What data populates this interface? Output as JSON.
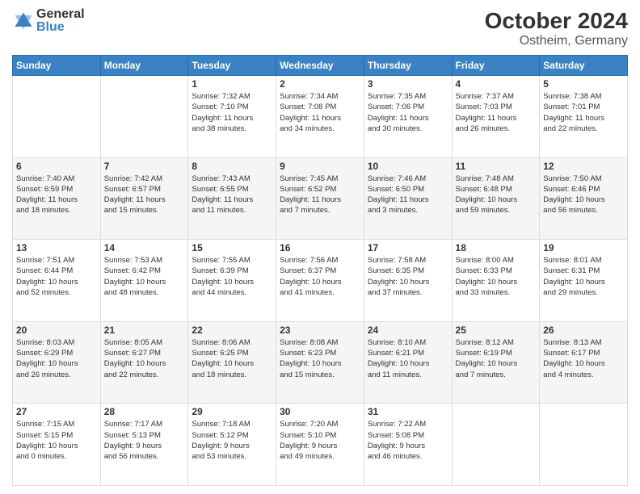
{
  "logo": {
    "general": "General",
    "blue": "Blue"
  },
  "title": "October 2024",
  "subtitle": "Ostheim, Germany",
  "days_of_week": [
    "Sunday",
    "Monday",
    "Tuesday",
    "Wednesday",
    "Thursday",
    "Friday",
    "Saturday"
  ],
  "weeks": [
    [
      {
        "day": "",
        "info": ""
      },
      {
        "day": "",
        "info": ""
      },
      {
        "day": "1",
        "info": "Sunrise: 7:32 AM\nSunset: 7:10 PM\nDaylight: 11 hours\nand 38 minutes."
      },
      {
        "day": "2",
        "info": "Sunrise: 7:34 AM\nSunset: 7:08 PM\nDaylight: 11 hours\nand 34 minutes."
      },
      {
        "day": "3",
        "info": "Sunrise: 7:35 AM\nSunset: 7:06 PM\nDaylight: 11 hours\nand 30 minutes."
      },
      {
        "day": "4",
        "info": "Sunrise: 7:37 AM\nSunset: 7:03 PM\nDaylight: 11 hours\nand 26 minutes."
      },
      {
        "day": "5",
        "info": "Sunrise: 7:38 AM\nSunset: 7:01 PM\nDaylight: 11 hours\nand 22 minutes."
      }
    ],
    [
      {
        "day": "6",
        "info": "Sunrise: 7:40 AM\nSunset: 6:59 PM\nDaylight: 11 hours\nand 18 minutes."
      },
      {
        "day": "7",
        "info": "Sunrise: 7:42 AM\nSunset: 6:57 PM\nDaylight: 11 hours\nand 15 minutes."
      },
      {
        "day": "8",
        "info": "Sunrise: 7:43 AM\nSunset: 6:55 PM\nDaylight: 11 hours\nand 11 minutes."
      },
      {
        "day": "9",
        "info": "Sunrise: 7:45 AM\nSunset: 6:52 PM\nDaylight: 11 hours\nand 7 minutes."
      },
      {
        "day": "10",
        "info": "Sunrise: 7:46 AM\nSunset: 6:50 PM\nDaylight: 11 hours\nand 3 minutes."
      },
      {
        "day": "11",
        "info": "Sunrise: 7:48 AM\nSunset: 6:48 PM\nDaylight: 10 hours\nand 59 minutes."
      },
      {
        "day": "12",
        "info": "Sunrise: 7:50 AM\nSunset: 6:46 PM\nDaylight: 10 hours\nand 56 minutes."
      }
    ],
    [
      {
        "day": "13",
        "info": "Sunrise: 7:51 AM\nSunset: 6:44 PM\nDaylight: 10 hours\nand 52 minutes."
      },
      {
        "day": "14",
        "info": "Sunrise: 7:53 AM\nSunset: 6:42 PM\nDaylight: 10 hours\nand 48 minutes."
      },
      {
        "day": "15",
        "info": "Sunrise: 7:55 AM\nSunset: 6:39 PM\nDaylight: 10 hours\nand 44 minutes."
      },
      {
        "day": "16",
        "info": "Sunrise: 7:56 AM\nSunset: 6:37 PM\nDaylight: 10 hours\nand 41 minutes."
      },
      {
        "day": "17",
        "info": "Sunrise: 7:58 AM\nSunset: 6:35 PM\nDaylight: 10 hours\nand 37 minutes."
      },
      {
        "day": "18",
        "info": "Sunrise: 8:00 AM\nSunset: 6:33 PM\nDaylight: 10 hours\nand 33 minutes."
      },
      {
        "day": "19",
        "info": "Sunrise: 8:01 AM\nSunset: 6:31 PM\nDaylight: 10 hours\nand 29 minutes."
      }
    ],
    [
      {
        "day": "20",
        "info": "Sunrise: 8:03 AM\nSunset: 6:29 PM\nDaylight: 10 hours\nand 26 minutes."
      },
      {
        "day": "21",
        "info": "Sunrise: 8:05 AM\nSunset: 6:27 PM\nDaylight: 10 hours\nand 22 minutes."
      },
      {
        "day": "22",
        "info": "Sunrise: 8:06 AM\nSunset: 6:25 PM\nDaylight: 10 hours\nand 18 minutes."
      },
      {
        "day": "23",
        "info": "Sunrise: 8:08 AM\nSunset: 6:23 PM\nDaylight: 10 hours\nand 15 minutes."
      },
      {
        "day": "24",
        "info": "Sunrise: 8:10 AM\nSunset: 6:21 PM\nDaylight: 10 hours\nand 11 minutes."
      },
      {
        "day": "25",
        "info": "Sunrise: 8:12 AM\nSunset: 6:19 PM\nDaylight: 10 hours\nand 7 minutes."
      },
      {
        "day": "26",
        "info": "Sunrise: 8:13 AM\nSunset: 6:17 PM\nDaylight: 10 hours\nand 4 minutes."
      }
    ],
    [
      {
        "day": "27",
        "info": "Sunrise: 7:15 AM\nSunset: 5:15 PM\nDaylight: 10 hours\nand 0 minutes."
      },
      {
        "day": "28",
        "info": "Sunrise: 7:17 AM\nSunset: 5:13 PM\nDaylight: 9 hours\nand 56 minutes."
      },
      {
        "day": "29",
        "info": "Sunrise: 7:18 AM\nSunset: 5:12 PM\nDaylight: 9 hours\nand 53 minutes."
      },
      {
        "day": "30",
        "info": "Sunrise: 7:20 AM\nSunset: 5:10 PM\nDaylight: 9 hours\nand 49 minutes."
      },
      {
        "day": "31",
        "info": "Sunrise: 7:22 AM\nSunset: 5:08 PM\nDaylight: 9 hours\nand 46 minutes."
      },
      {
        "day": "",
        "info": ""
      },
      {
        "day": "",
        "info": ""
      }
    ]
  ]
}
